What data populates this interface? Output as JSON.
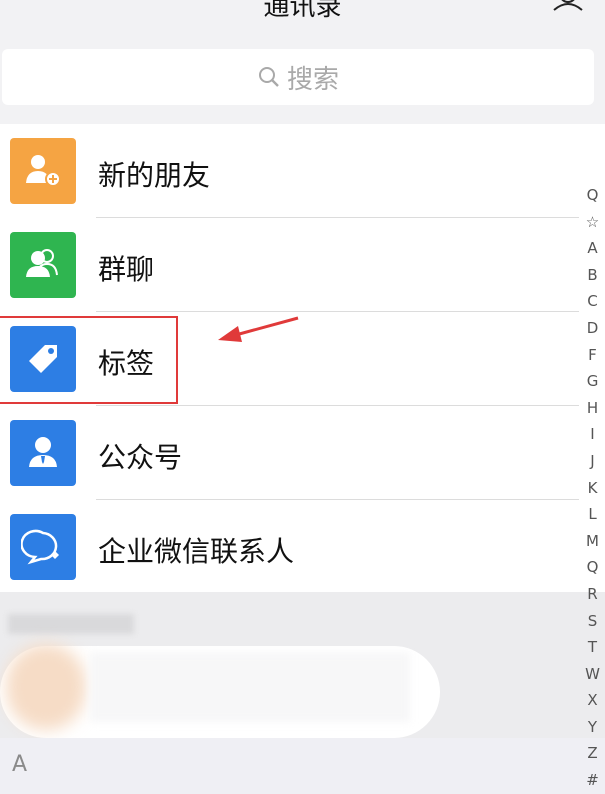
{
  "header": {
    "title": "通讯录"
  },
  "search": {
    "placeholder": "搜索"
  },
  "items": [
    {
      "label": "新的朋友",
      "color": "#f5a443",
      "icon": "add-friend-icon"
    },
    {
      "label": "群聊",
      "color": "#2fb550",
      "icon": "group-chat-icon"
    },
    {
      "label": "标签",
      "color": "#2d7ee4",
      "icon": "tag-icon"
    },
    {
      "label": "公众号",
      "color": "#2d7ee4",
      "icon": "official-account-icon"
    },
    {
      "label": "企业微信联系人",
      "color": "#2d7ee4",
      "icon": "enterprise-contact-icon"
    }
  ],
  "section": {
    "letter": "A"
  },
  "index": [
    "Q",
    "☆",
    "A",
    "B",
    "C",
    "D",
    "F",
    "G",
    "H",
    "I",
    "J",
    "K",
    "L",
    "M",
    "Q",
    "R",
    "S",
    "T",
    "W",
    "X",
    "Y",
    "Z",
    "#"
  ],
  "annotation_color": "#e03a3a"
}
